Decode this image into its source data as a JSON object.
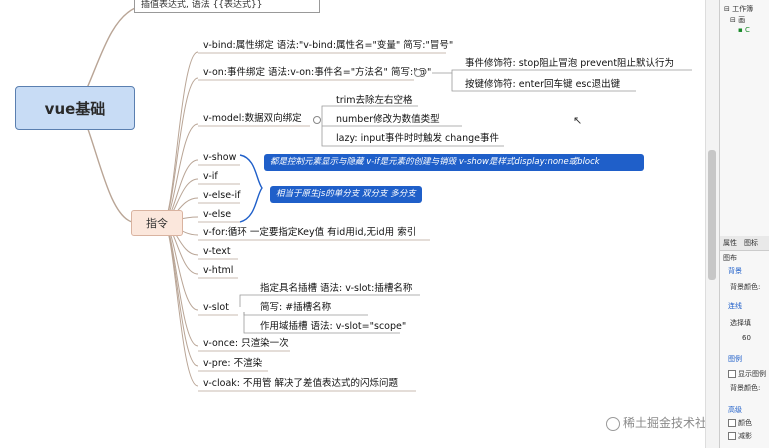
{
  "mindmap": {
    "root": "vue基础",
    "top_partial": "插值表达式, 语法 {{表达式}}",
    "zhiling": "指令",
    "items": [
      "v-bind:属性绑定 语法:\"v-bind:属性名=\"变量\" 简写:\"冒号\"",
      "v-on:事件绑定 语法:v-on:事件名=\"方法名\" 简写:\"@\"",
      "v-model:数据双向绑定",
      "v-show",
      "v-if",
      "v-else-if",
      "v-else",
      "v-for:循环 一定要指定Key值 有id用id,无id用 索引",
      "v-text",
      "v-html",
      "v-slot",
      "v-once: 只渲染一次",
      "v-pre: 不渲染",
      "v-cloak: 不用管 解决了差值表达式的闪烁问题"
    ],
    "von_children": [
      "事件修饰符: stop阻止冒泡  prevent阻止默认行为",
      "按键修饰符: enter回车键  esc退出键"
    ],
    "vmodel_children": [
      "trim去除左右空格",
      "number修改为数值类型",
      "lazy: input事件时时触发 change事件"
    ],
    "vslot_children": [
      "指定具名插槽 语法: v-slot:插槽名称",
      "简写: #插槽名称",
      "作用域插槽 语法: v-slot=\"scope\""
    ],
    "callouts": [
      "都是控制元素显示与隐藏 v-if是元素的创建与销毁 v-show是样式display:none或block",
      "相当于原生js的单分支 双分支 多分支"
    ]
  },
  "side_panel": {
    "tree_items": [
      "工作簿",
      "画",
      "C"
    ],
    "tabs": [
      "属性",
      "图标"
    ],
    "section_title": "图布",
    "labels": [
      "背景",
      "背景颜色:",
      "连线",
      "选择填",
      "60",
      "图例",
      "显示图例",
      "背景颜色:",
      "高级"
    ],
    "checkbox_labels": [
      "颜色",
      "减影"
    ]
  },
  "watermark": "稀土掘金技术社区",
  "colors": {
    "root_fill": "#c8dcf5",
    "callout_fill": "#1f5fc9",
    "zhiling_fill": "#fbe7dc",
    "branch_line": "#b9a596"
  }
}
